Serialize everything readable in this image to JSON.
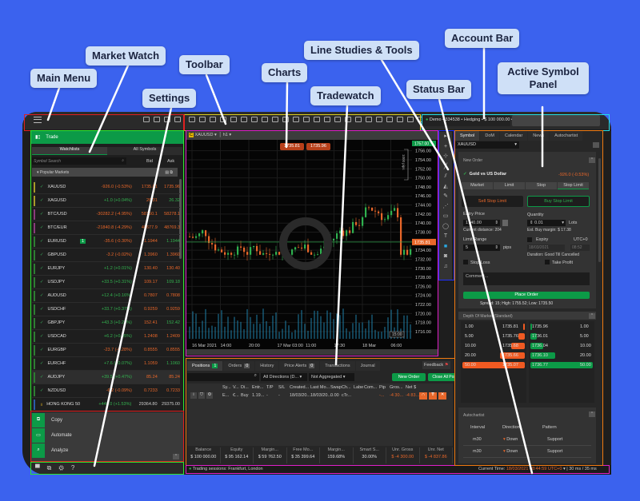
{
  "annotations": {
    "main_menu": "Main Menu",
    "market_watch": "Market Watch",
    "toolbar": "Toolbar",
    "settings": "Settings",
    "charts": "Charts",
    "line_studies": "Line Studies & Tools",
    "tradewatch": "Tradewatch",
    "status_bar": "Status Bar",
    "account_bar": "Account Bar",
    "active_symbol_panel": "Active Symbol Panel"
  },
  "sidebar": {
    "trade_label": "Trade",
    "tabs": [
      "Watchlists",
      "All Symbols"
    ],
    "search_placeholder": "Symbol Search",
    "bid": "Bid",
    "ask": "Ask",
    "group": "Popular Markets",
    "rows": [
      {
        "sym": "XAUUSD",
        "chg": "-926.0 (-0.53%)",
        "bid": "1735.81",
        "ask": "1735.96",
        "dir": "dn",
        "bar": "#a89a2a"
      },
      {
        "sym": "XAGUSD",
        "chg": "+1.0 (+0.04%)",
        "bid": "26.31",
        "ask": "26.32",
        "dir": "up",
        "bar": "#a89a2a"
      },
      {
        "sym": "BTC/USD",
        "chg": "-30282.2 (-4.95%)",
        "bid": "58150.1",
        "ask": "58278.1",
        "dir": "dn",
        "bar": "#8a3b7a"
      },
      {
        "sym": "BTC/EUR",
        "chg": "-21840.8 (-4.29%)",
        "bid": "48677.9",
        "ask": "48769.3",
        "dir": "dn",
        "bar": "#8a3b7a"
      },
      {
        "sym": "EURUSD",
        "chg": "-35.6 (-0.30%)",
        "bid": "1.1944",
        "ask": "1.1944",
        "dir": "dn",
        "bar": "#2e7d32",
        "badge": "1"
      },
      {
        "sym": "GBPUSD",
        "chg": "-3.2 (-0.02%)",
        "bid": "1.3960",
        "ask": "1.3960",
        "dir": "dn",
        "bar": "#2e7d32"
      },
      {
        "sym": "EURJPY",
        "chg": "+1.2 (+0.01%)",
        "bid": "130.40",
        "ask": "130.40",
        "dir": "up",
        "bar": "#2e7d32"
      },
      {
        "sym": "USDJPY",
        "chg": "+33.5 (+0.31%)",
        "bid": "109.17",
        "ask": "109.18",
        "dir": "up",
        "bar": "#2e7d32"
      },
      {
        "sym": "AUDUSD",
        "chg": "+12.4 (+0.16%)",
        "bid": "0.7807",
        "ask": "0.7808",
        "dir": "up",
        "bar": "#2e7d32"
      },
      {
        "sym": "USDCHF",
        "chg": "+33.7 (+0.37%)",
        "bid": "0.9259",
        "ask": "0.9259",
        "dir": "up",
        "bar": "#2e7d32"
      },
      {
        "sym": "GBPJPY",
        "chg": "+43.3 (+0.28%)",
        "bid": "152.41",
        "ask": "152.42",
        "dir": "up",
        "bar": "#2e7d32"
      },
      {
        "sym": "USDCAD",
        "chg": "+6.2 (+0.05%)",
        "bid": "1.2408",
        "ask": "1.2409",
        "dir": "up",
        "bar": "#2e7d32"
      },
      {
        "sym": "EURGBP",
        "chg": "-23.7 (-0.28%)",
        "bid": "0.8555",
        "ask": "0.8555",
        "dir": "dn",
        "bar": "#2e7d32"
      },
      {
        "sym": "EURCHF",
        "chg": "+7.6 (+0.07%)",
        "bid": "1.1059",
        "ask": "1.1060",
        "dir": "up",
        "bar": "#2e7d32"
      },
      {
        "sym": "AUDJPY",
        "chg": "+39.5 (+0.47%)",
        "bid": "85.24",
        "ask": "85.24",
        "dir": "up",
        "bar": "#2e7d32"
      },
      {
        "sym": "NZDUSD",
        "chg": "-6.2 (-0.09%)",
        "bid": "0.7233",
        "ask": "0.7233",
        "dir": "dn",
        "bar": "#2e7d32"
      },
      {
        "sym": "HONG KONG 50",
        "chg": "+448.0 (+1.53%)",
        "bid": "29364.80",
        "ask": "29375.00",
        "dir": "up",
        "bar": "#2a5caa"
      }
    ],
    "apps": [
      "Copy",
      "Automate",
      "Analyze"
    ]
  },
  "account": {
    "text": "Demo • 334538 • Hedging • $ 100 000.00 • 1:100"
  },
  "chart": {
    "symbol": "XAUUSD",
    "timeframe": "h1",
    "sell": "1735.81",
    "buy": "1735.96",
    "current": "1735.81",
    "top_price": "1757.00",
    "pips_label": "1000 pips",
    "y_ticks": [
      "1756.00",
      "1754.00",
      "1752.00",
      "1750.00",
      "1748.00",
      "1746.00",
      "1744.00",
      "1742.00",
      "1740.00",
      "1738.00",
      "1736.00",
      "1734.00",
      "1732.00",
      "1730.00",
      "1728.00",
      "1726.00",
      "1724.00",
      "1722.00",
      "1720.00",
      "1718.00",
      "1716.00"
    ],
    "x_ticks": [
      "16 Mar 2021",
      "14:00",
      "20:00",
      "17 Mar 03:00",
      "11:00",
      "17:30",
      "18 Mar",
      "06:00"
    ],
    "x_marker": "15:00"
  },
  "symbol_panel": {
    "tabs": [
      "Symbol",
      "DoM",
      "Calendar",
      "News",
      "Autochartist"
    ],
    "symbol": "XAUUSD",
    "new_order": "New Order",
    "name": "Gold vs US Dollar",
    "change": "-926.0 (-0.53%)",
    "order_types": [
      "Market",
      "Limit",
      "Stop",
      "Stop Limit"
    ],
    "sell": "Sell Stop Limit",
    "buy": "Buy Stop Limit",
    "entry_label": "Entry Price",
    "entry": "1740.00",
    "distance": "Current distance: 204",
    "qty_label": "Quantity",
    "qty": "0.01",
    "lots": "Lots",
    "margin": "Est. Buy margin: $ 17.38",
    "limit_label": "Limit Range",
    "limit": "5",
    "pips": "pips",
    "expiry": "Expiry",
    "utc": "UTC+0",
    "exp_date": "18/03/2021",
    "exp_time": "08:52",
    "duration": "Duration: Good Till Cancelled",
    "stop_loss": "Stop Loss",
    "take_profit": "Take Profit",
    "comment": "Comment...",
    "place": "Place Order",
    "spread": "Spread: 15; High: 1755.52; Low: 1735.50",
    "dom_title": "Depth Of Market (Standard)",
    "dom_bid": [
      {
        "v": "1.00",
        "p": "1735.81",
        "f": 0.02
      },
      {
        "v": "5.00",
        "p": "1735.76",
        "f": 0.1
      },
      {
        "v": "10.00",
        "p": "1735.68",
        "f": 0.22
      },
      {
        "v": "20.00",
        "p": "1735.66",
        "f": 0.4
      },
      {
        "v": "50.00",
        "p": "1735.07",
        "f": 1
      }
    ],
    "dom_ask": [
      {
        "v": "1.00",
        "p": "1735.96",
        "f": 0.02
      },
      {
        "v": "5.00",
        "p": "1736.01",
        "f": 0.1
      },
      {
        "v": "10.00",
        "p": "1736.04",
        "f": 0.2
      },
      {
        "v": "20.00",
        "p": "1736.10",
        "f": 0.4
      },
      {
        "v": "50.00",
        "p": "1736.77",
        "f": 1
      }
    ],
    "auto_title": "Autochartist",
    "auto_cols": [
      "Interval",
      "Direction",
      "Pattern"
    ],
    "auto_rows": [
      {
        "i": "m30",
        "d": "Down",
        "p": "Support"
      },
      {
        "i": "m30",
        "d": "Down",
        "p": "Support"
      }
    ]
  },
  "tradewatch": {
    "tabs": [
      {
        "l": "Positions",
        "b": "1"
      },
      {
        "l": "Orders",
        "b": "0"
      },
      {
        "l": "History"
      },
      {
        "l": "Price Alerts",
        "b": "0"
      },
      {
        "l": "Transactions"
      },
      {
        "l": "Journal"
      }
    ],
    "feedback": "Feedback",
    "directions": "All Directions (D...",
    "aggregation": "Not Aggregated",
    "new_order": "New Order",
    "close_all": "Close All Positions",
    "cols": [
      "Sy...",
      "V...",
      "Di...",
      "Entr...",
      "T/P",
      "S/L",
      "Created...",
      "Last Mo...",
      "Swap",
      "Ch...",
      "Labe",
      "Com...",
      "Pip",
      "Gros...",
      "Net $"
    ],
    "row": [
      "E...",
      "€...",
      "Buy",
      "1.19...",
      "-",
      "-",
      "18/03/20...",
      "18/03/20...",
      "0.00",
      "cTr...",
      "",
      "",
      "-...",
      "-4 30...",
      "-4 83..."
    ],
    "summary": [
      {
        "l": "Balance",
        "v": "$ 100 000.00"
      },
      {
        "l": "Equity",
        "v": "$ 95 162.14"
      },
      {
        "l": "Margin...",
        "v": "$ 59 762.50"
      },
      {
        "l": "Free Mo...",
        "v": "$ 35 399.64"
      },
      {
        "l": "Margin...",
        "v": "159.68%"
      },
      {
        "l": "Smart S...",
        "v": "30.00%"
      },
      {
        "l": "Unr. Gross",
        "v": "$ -4 300.00",
        "neg": true
      },
      {
        "l": "Unr. Net",
        "v": "$ -4 837.86",
        "neg": true
      }
    ]
  },
  "status": {
    "sessions": "Trading sessions: Frankfurt, London",
    "time_label": "Current Time:",
    "time": "18/03/2021 08:44:59",
    "tz": "UTC+0",
    "latency": "30 ms / 35 ms"
  },
  "colors": {
    "accent_green": "#0c9a47",
    "sell_orange": "#e8672a",
    "background": "#3b62ee"
  }
}
